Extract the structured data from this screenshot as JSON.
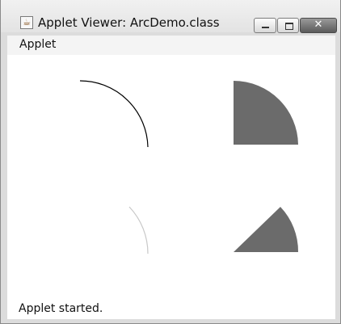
{
  "window": {
    "title": "Applet Viewer: ArcDemo.class",
    "icon": "java-coffee-cup-icon"
  },
  "menubar": {
    "items": [
      "Applet"
    ]
  },
  "status": {
    "text": "Applet started."
  },
  "canvas": {
    "arc_stroke_color": "#000000",
    "light_arc_color": "#c8c8c8",
    "fill_color": "#6b6b6b"
  }
}
